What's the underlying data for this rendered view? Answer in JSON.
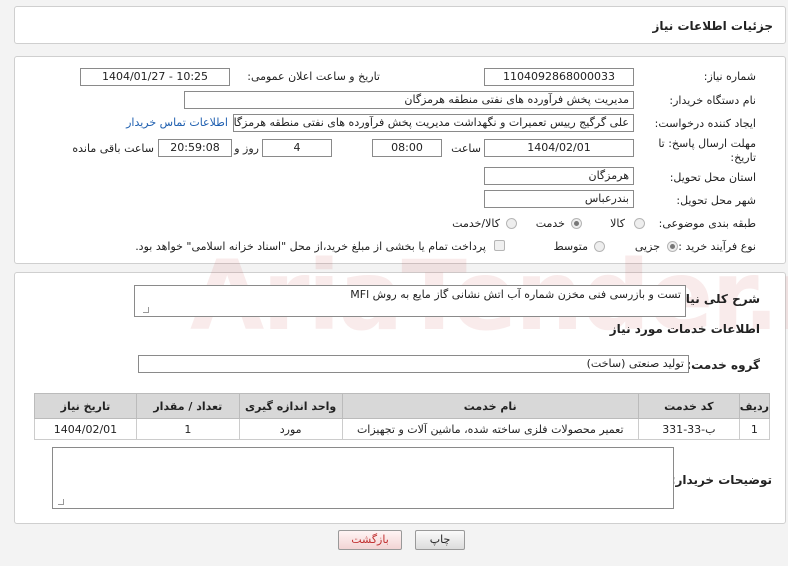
{
  "header": {
    "title": "جزئیات اطلاعات نیاز"
  },
  "form": {
    "need_number_label": "شماره نیاز:",
    "need_number": "1104092868000033",
    "announce_label": "تاریخ و ساعت اعلان عمومی:",
    "announce_value": "1404/01/27 - 10:25",
    "buyer_org_label": "نام دستگاه خریدار:",
    "buyer_org": "مدیریت پخش فرآورده های نفتی منطقه هرمزگان",
    "creator_label": "ایجاد کننده درخواست:",
    "creator": "علی گرگیج رییس تعمیرات و نگهداشت مدیریت پخش فرآورده های نفتی منطقه هرمزگان",
    "contact_link": "اطلاعات تماس خریدار",
    "deadline_label_1": "مهلت ارسال پاسخ: تا",
    "deadline_label_2": "تاریخ:",
    "deadline_date": "1404/02/01",
    "time_label": "ساعت",
    "deadline_time": "08:00",
    "days_value": "4",
    "days_label": "روز و",
    "remaining_time": "20:59:08",
    "remaining_label": "ساعت باقی مانده",
    "province_label": "استان محل تحویل:",
    "province": "هرمزگان",
    "city_label": "شهر محل تحویل:",
    "city": "بندرعباس",
    "category_label": "طبقه بندی موضوعی:",
    "category_options": [
      "کالا",
      "خدمت",
      "کالا/خدمت"
    ],
    "category_selected": "خدمت",
    "process_label": "نوع فرآیند خرید :",
    "process_options": [
      "جزیی",
      "متوسط"
    ],
    "process_selected": "جزیی",
    "payment_note": "پرداخت تمام یا بخشی از مبلغ خرید،از محل \"اسناد خزانه اسلامی\" خواهد بود."
  },
  "details": {
    "summary_label": "شرح کلی نیاز:",
    "summary": "تست و بازرسی فنی مخزن شماره  آب اتش نشانی گاز مایع به روش MFl",
    "services_heading": "اطلاعات خدمات مورد نیاز",
    "group_label": "گروه خدمت:",
    "group_value": "تولید صنعتی (ساخت)",
    "table_headers": [
      "ردیف",
      "کد خدمت",
      "نام خدمت",
      "واحد اندازه گیری",
      "تعداد / مقدار",
      "تاریخ نیاز"
    ],
    "table_rows": [
      [
        "1",
        "ب-33-331",
        "تعمیر محصولات فلزی ساخته شده، ماشین آلات و تجهیزات",
        "مورد",
        "1",
        "1404/02/01"
      ]
    ],
    "buyer_notes_label": "توضیحات خریدار:",
    "buyer_notes": ""
  },
  "buttons": {
    "print": "چاپ",
    "back": "بازگشت"
  },
  "watermark": "AriaTender.neT",
  "colors": {
    "link": "#2060b0",
    "back_text": "#c03030"
  }
}
